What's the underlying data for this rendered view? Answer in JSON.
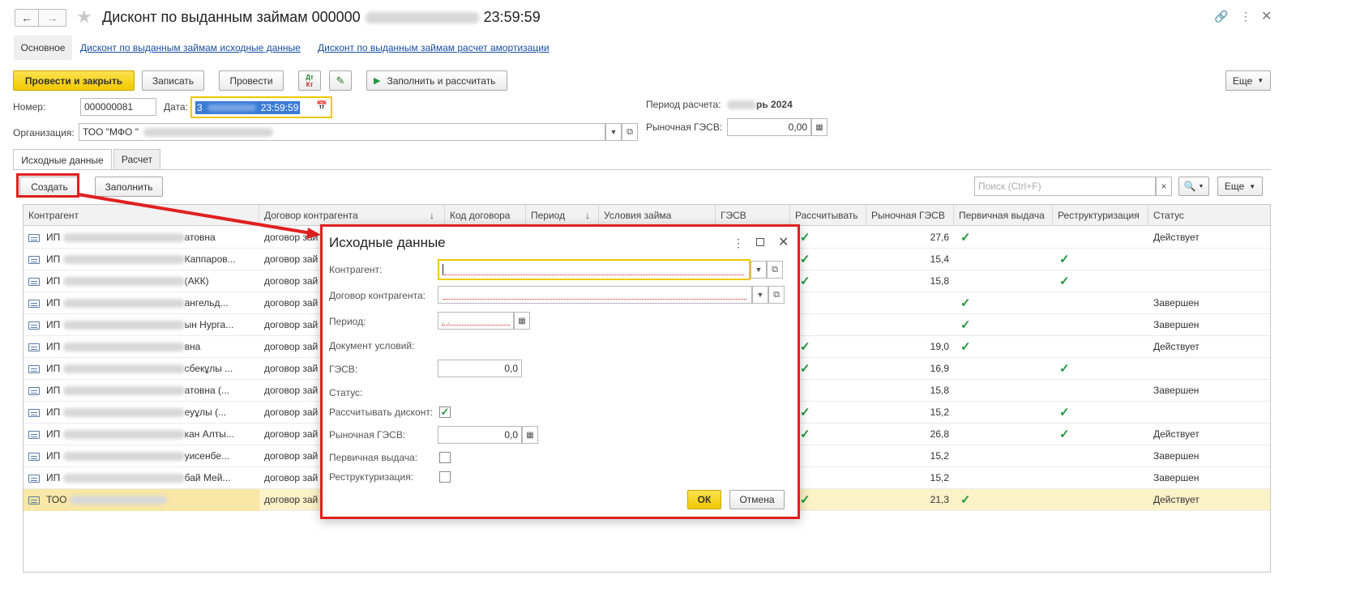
{
  "window": {
    "title_prefix": "Дисконт по выданным займам 000000",
    "title_time": "23:59:59"
  },
  "nav_tabs": [
    {
      "label": "Основное"
    },
    {
      "label": "Дисконт по выданным займам исходные данные"
    },
    {
      "label": "Дисконт по выданным займам расчет амортизации"
    }
  ],
  "toolbar": {
    "post_close": "Провести и закрыть",
    "save": "Записать",
    "post": "Провести",
    "dtkt_top": "Дт",
    "dtkt_bottom": "Кт",
    "fill_calc": "Заполнить и рассчитать",
    "more": "Еще"
  },
  "header": {
    "number_label": "Номер:",
    "number_value": "000000081",
    "date_label": "Дата:",
    "date_value_prefix": "3",
    "date_value_time": "23:59:59",
    "org_label": "Организация:",
    "org_value": "ТОО \"МФО \"",
    "period_label": "Период расчета:",
    "period_value": "рь 2024",
    "market_label": "Рыночная ГЭСВ:",
    "market_value": "0,00"
  },
  "content_tabs": [
    {
      "label": "Исходные данные"
    },
    {
      "label": "Расчет"
    }
  ],
  "table_toolbar": {
    "create": "Создать",
    "fill": "Заполнить",
    "search_placeholder": "Поиск (Ctrl+F)",
    "clear": "×",
    "more": "Еще"
  },
  "table": {
    "columns": [
      "Контрагент",
      "Договор контрагента",
      "Код договора",
      "Период",
      "Условия займа",
      "ГЭСВ",
      "Рассчитывать",
      "Рыночная ГЭСВ",
      "Первичная выдача",
      "Реструктуризация",
      "Статус"
    ],
    "rows": [
      {
        "prefix": "ИП",
        "suffix": "атовна",
        "contract": "договор зай",
        "market": "27,6",
        "calc": true,
        "primary": true,
        "restr": false,
        "status": "Действует"
      },
      {
        "prefix": "ИП",
        "suffix": "Каппаров...",
        "contract": "договор зай",
        "market": "15,4",
        "calc": true,
        "primary": false,
        "restr": true,
        "status": ""
      },
      {
        "prefix": "ИП",
        "suffix": "(АКК)",
        "contract": "договор зай",
        "market": "15,8",
        "calc": true,
        "primary": false,
        "restr": true,
        "status": ""
      },
      {
        "prefix": "ИП",
        "suffix": "ангельд...",
        "contract": "договор зай",
        "market": "",
        "calc": false,
        "primary": true,
        "restr": false,
        "status": "Завершен"
      },
      {
        "prefix": "ИП",
        "suffix": "ын Нурга...",
        "contract": "договор зай",
        "market": "",
        "calc": false,
        "primary": true,
        "restr": false,
        "status": "Завершен"
      },
      {
        "prefix": "ИП",
        "suffix": "вна",
        "contract": "договор зай",
        "market": "19,0",
        "calc": true,
        "primary": true,
        "restr": false,
        "status": "Действует"
      },
      {
        "prefix": "ИП",
        "suffix": "сбекұлы ...",
        "contract": "договор зай",
        "market": "16,9",
        "calc": true,
        "primary": false,
        "restr": true,
        "status": ""
      },
      {
        "prefix": "ИП",
        "suffix": "атовна (...",
        "contract": "договор зай",
        "market": "15,8",
        "calc": false,
        "primary": false,
        "restr": false,
        "status": "Завершен"
      },
      {
        "prefix": "ИП",
        "suffix": "еуұлы (...",
        "contract": "договор зай",
        "market": "15,2",
        "calc": true,
        "primary": false,
        "restr": true,
        "status": ""
      },
      {
        "prefix": "ИП",
        "suffix": "кан Алты...",
        "contract": "договор зай",
        "market": "26,8",
        "calc": true,
        "primary": false,
        "restr": true,
        "status": "Действует"
      },
      {
        "prefix": "ИП",
        "suffix": "уисенбе...",
        "contract": "договор зай",
        "market": "15,2",
        "calc": false,
        "primary": false,
        "restr": false,
        "status": "Завершен"
      },
      {
        "prefix": "ИП",
        "suffix": "бай Мей...",
        "contract": "договор зай",
        "market": "15,2",
        "calc": false,
        "primary": false,
        "restr": false,
        "status": "Завершен"
      },
      {
        "prefix": "ТОО",
        "suffix": "",
        "contract": "договор зай",
        "market": "21,3",
        "calc": true,
        "primary": true,
        "restr": false,
        "status": "Действует"
      }
    ]
  },
  "dialog": {
    "title": "Исходные данные",
    "kontragent_label": "Контрагент:",
    "dogovor_label": "Договор контрагента:",
    "period_label": "Период:",
    "period_value": ".  .",
    "doc_label": "Документ условий:",
    "gesv_label": "ГЭСВ:",
    "gesv_value": "0,0",
    "status_label": "Статус:",
    "calc_label": "Рассчитывать дисконт:",
    "market_label": "Рыночная ГЭСВ:",
    "market_value": "0,0",
    "primary_label": "Первичная выдача:",
    "restr_label": "Реструктуризация:",
    "ok": "ОК",
    "cancel": "Отмена"
  },
  "colors": {
    "accent_yellow": "#f5d10b",
    "highlight_red": "#e02020",
    "check_green": "#1e9a3c",
    "link_blue": "#1a4fa0"
  }
}
